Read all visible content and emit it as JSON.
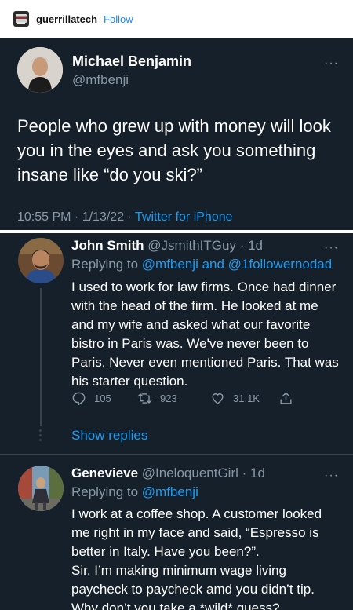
{
  "tumblr": {
    "blog_name": "guerrillatech",
    "follow_label": "Follow"
  },
  "tweet": {
    "author_name": "Michael Benjamin",
    "author_handle": "@mfbenji",
    "text": "People who grew up with money will look you in the eyes and ask you something  insane like “do you ski?”",
    "time": "10:55 PM · 1/13/22 · ",
    "source": "Twitter for iPhone",
    "more": "···"
  },
  "replies": [
    {
      "name": "John Smith",
      "handle": "@JsmithITGuy",
      "time": " · 1d",
      "replying_prefix": "Replying to ",
      "replying_mentions": "@mfbenji and @1followernodad",
      "text": "I used to work for law firms. Once had dinner with the head of the firm. He looked at me and my wife and asked what our favorite bistro in Paris was. We've never been to Paris. Never even mentioned Paris. That was his starter question.",
      "reply_count": "105",
      "retweet_count": "923",
      "like_count": "31.1K",
      "show_replies": "Show replies",
      "more": "···"
    },
    {
      "name": "Genevieve",
      "handle": "@IneloquentGirl",
      "time": " · 1d",
      "replying_prefix": "Replying to ",
      "replying_mentions": "@mfbenji",
      "text_lines": [
        "I work at a coffee shop. A customer looked me right in my face and said, “Espresso is better in Italy. Have you been?”.",
        "Sir. I’m making minimum wage living paycheck to paycheck amd you didn’t tip. Why don’t you take a *wild* guess?"
      ],
      "more": "···"
    }
  ],
  "colors": {
    "background": "#15202b",
    "accent": "#1d9bf0",
    "muted": "#8899a6",
    "text": "#ffffff"
  }
}
